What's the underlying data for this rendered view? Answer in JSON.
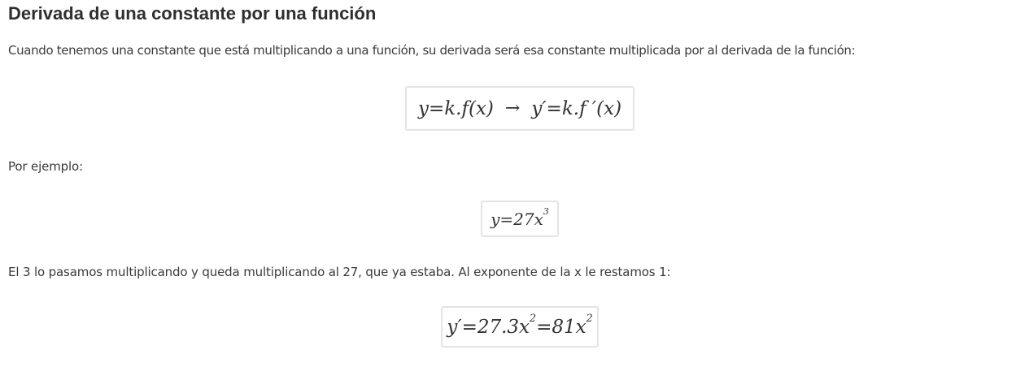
{
  "title": "Derivada de una constante por una función",
  "paragraphs": {
    "intro": "Cuando tenemos una constante que está multiplicando a una función, su derivada será esa constante multiplicada por al derivada de la función:",
    "example": "Por ejemplo:",
    "explanation": "El 3 lo pasamos multiplicando y queda multiplicando al 27, que ya estaba. Al exponente de la x le restamos 1:"
  },
  "formulas": {
    "rule": {
      "left": "y=k.f(x)",
      "arrow": "→",
      "right": "y′=k.f ′(x)"
    },
    "example": {
      "base": "y=27x",
      "exponent": "3"
    },
    "result": {
      "part1": "y′=27.3x",
      "exp1": "2",
      "part2": "=81x",
      "exp2": "2"
    }
  }
}
